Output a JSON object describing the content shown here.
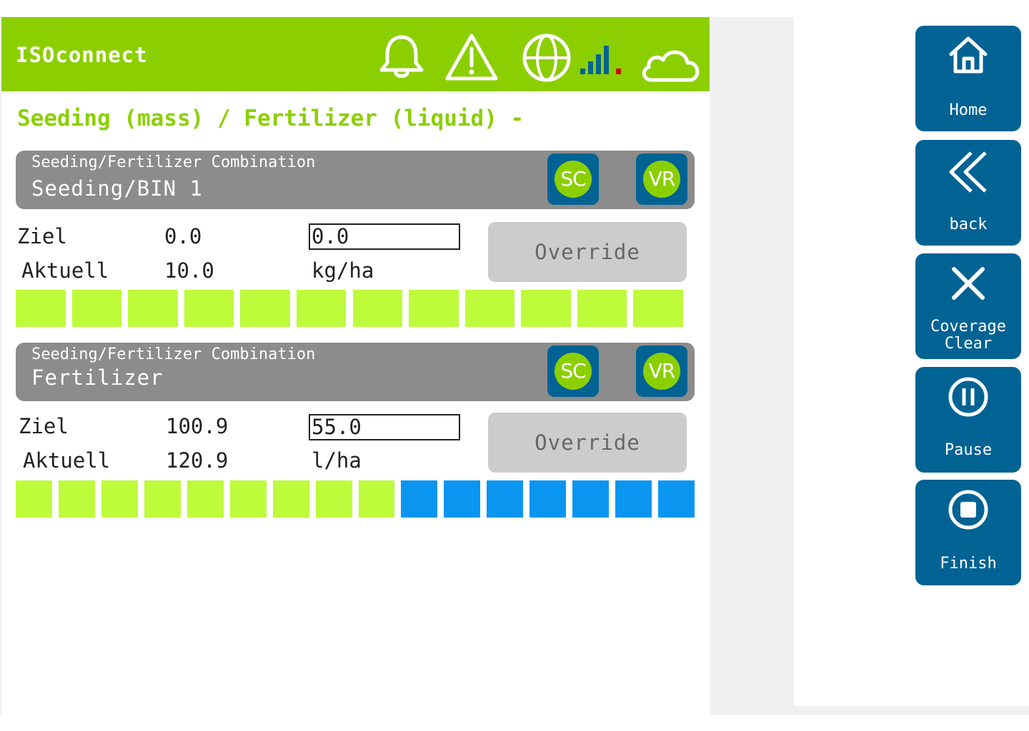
{
  "app": {
    "title": "ISOconnect"
  },
  "header": {
    "icons": [
      "bell-icon",
      "warning-icon",
      "globe-icon",
      "signal-bars-icon",
      "cloud-icon"
    ]
  },
  "page": {
    "title": "Seeding (mass) / Fertilizer (liquid) -"
  },
  "sections": [
    {
      "subtitle": "Seeding/Fertilizer Combination",
      "name": "Seeding/BIN 1",
      "sc_label": "SC",
      "vr_label": "VR",
      "target_label": "Ziel",
      "target_value": "0.0",
      "target_input": "0.0",
      "actual_label": "Aktuell",
      "actual_value": "10.0",
      "unit": "kg/ha",
      "override_label": "Override",
      "sections_on": 12,
      "sections_total": 12
    },
    {
      "subtitle": "Seeding/Fertilizer Combination",
      "name": "Fertilizer",
      "sc_label": "SC",
      "vr_label": "VR",
      "target_label": "Ziel",
      "target_value": "100.9",
      "target_input": "55.0",
      "actual_label": "Aktuell",
      "actual_value": "120.9",
      "unit": "l/ha",
      "override_label": "Override",
      "sections_on": 9,
      "sections_total": 16
    }
  ],
  "sidebar": {
    "home_label": "Home",
    "back_label": "back",
    "coverage_label_1": "Coverage",
    "coverage_label_2": "Clear",
    "pause_label": "Pause",
    "finish_label": "Finish"
  },
  "colors": {
    "brand_green": "#8ccf00",
    "section_on": "#bdfb3b",
    "section_off": "#0a96f0",
    "button_blue": "#006394",
    "bar_gray": "#8c8c8c"
  }
}
